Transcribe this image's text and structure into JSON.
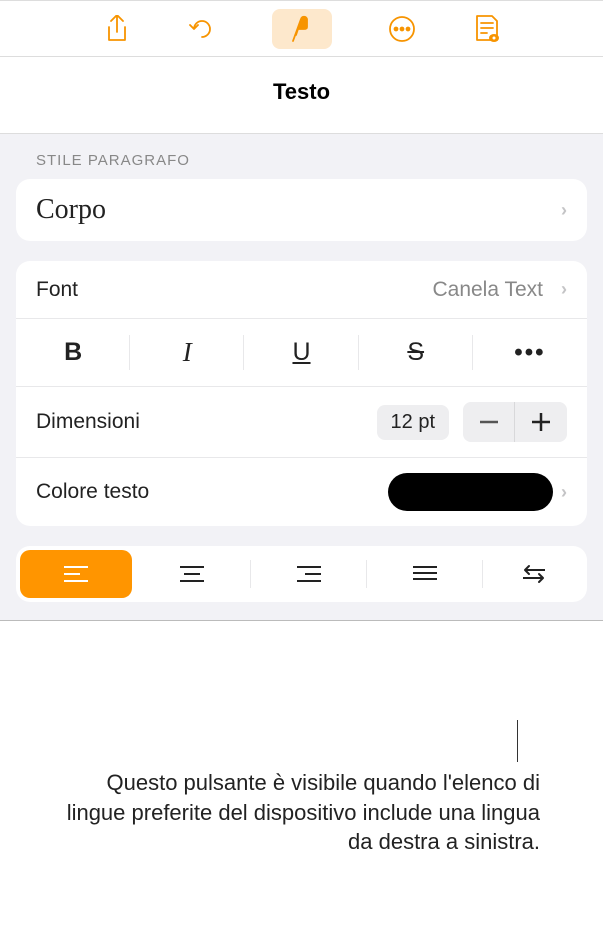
{
  "header_title": "Testo",
  "paragraph_style": {
    "section_label": "Stile paragrafo",
    "style_name": "Corpo"
  },
  "font": {
    "label": "Font",
    "value": "Canela Text"
  },
  "formatting": {
    "bold": "B",
    "italic": "I",
    "underline": "U",
    "strike": "S",
    "more": "•••"
  },
  "size": {
    "label": "Dimensioni",
    "value": "12 pt"
  },
  "text_color": {
    "label": "Colore testo",
    "value": "#000000"
  },
  "callout": "Questo pulsante è visibile quando l'elenco di lingue preferite del dispositivo include una lingua da destra a sinistra."
}
